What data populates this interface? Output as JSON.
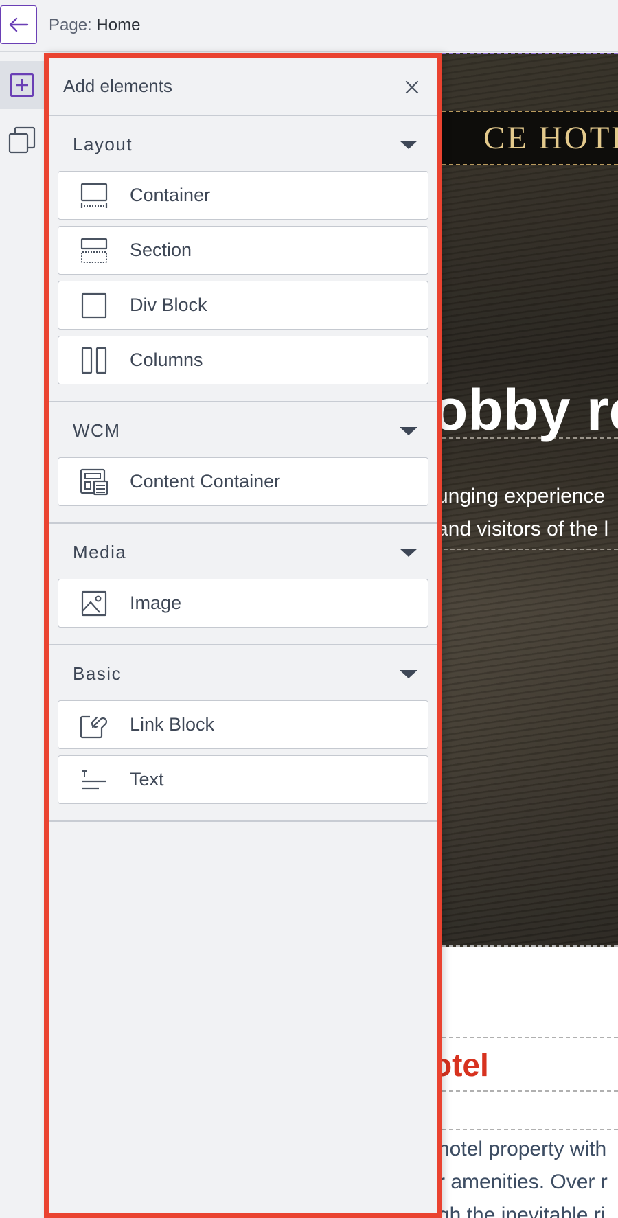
{
  "topbar": {
    "breadcrumb_label": "Page:",
    "breadcrumb_value": "Home"
  },
  "panel": {
    "title": "Add elements",
    "groups": [
      {
        "title": "Layout",
        "items": [
          {
            "label": "Container",
            "icon": "container-icon"
          },
          {
            "label": "Section",
            "icon": "section-icon"
          },
          {
            "label": "Div Block",
            "icon": "div-block-icon"
          },
          {
            "label": "Columns",
            "icon": "columns-icon"
          }
        ]
      },
      {
        "title": "WCM",
        "items": [
          {
            "label": "Content Container",
            "icon": "content-container-icon"
          }
        ]
      },
      {
        "title": "Media",
        "items": [
          {
            "label": "Image",
            "icon": "image-icon"
          }
        ]
      },
      {
        "title": "Basic",
        "items": [
          {
            "label": "Link Block",
            "icon": "link-block-icon"
          },
          {
            "label": "Text",
            "icon": "text-icon"
          }
        ]
      }
    ]
  },
  "canvas": {
    "hotel_name": "CE HOTEL",
    "hero_title": "obby re",
    "hero_sub_line1": "unging experience",
    "hero_sub_line2": "and visitors of the l",
    "section_title": "otel",
    "section_line1": "hotel property with",
    "section_line2": "r amenities. Over r",
    "section_line3": "gh the inevitable ri"
  },
  "colors": {
    "accent": "#6a3fb5",
    "highlight_border": "#ea4330",
    "section_title_red": "#d7321f",
    "banner_gold": "#e3c98c"
  }
}
